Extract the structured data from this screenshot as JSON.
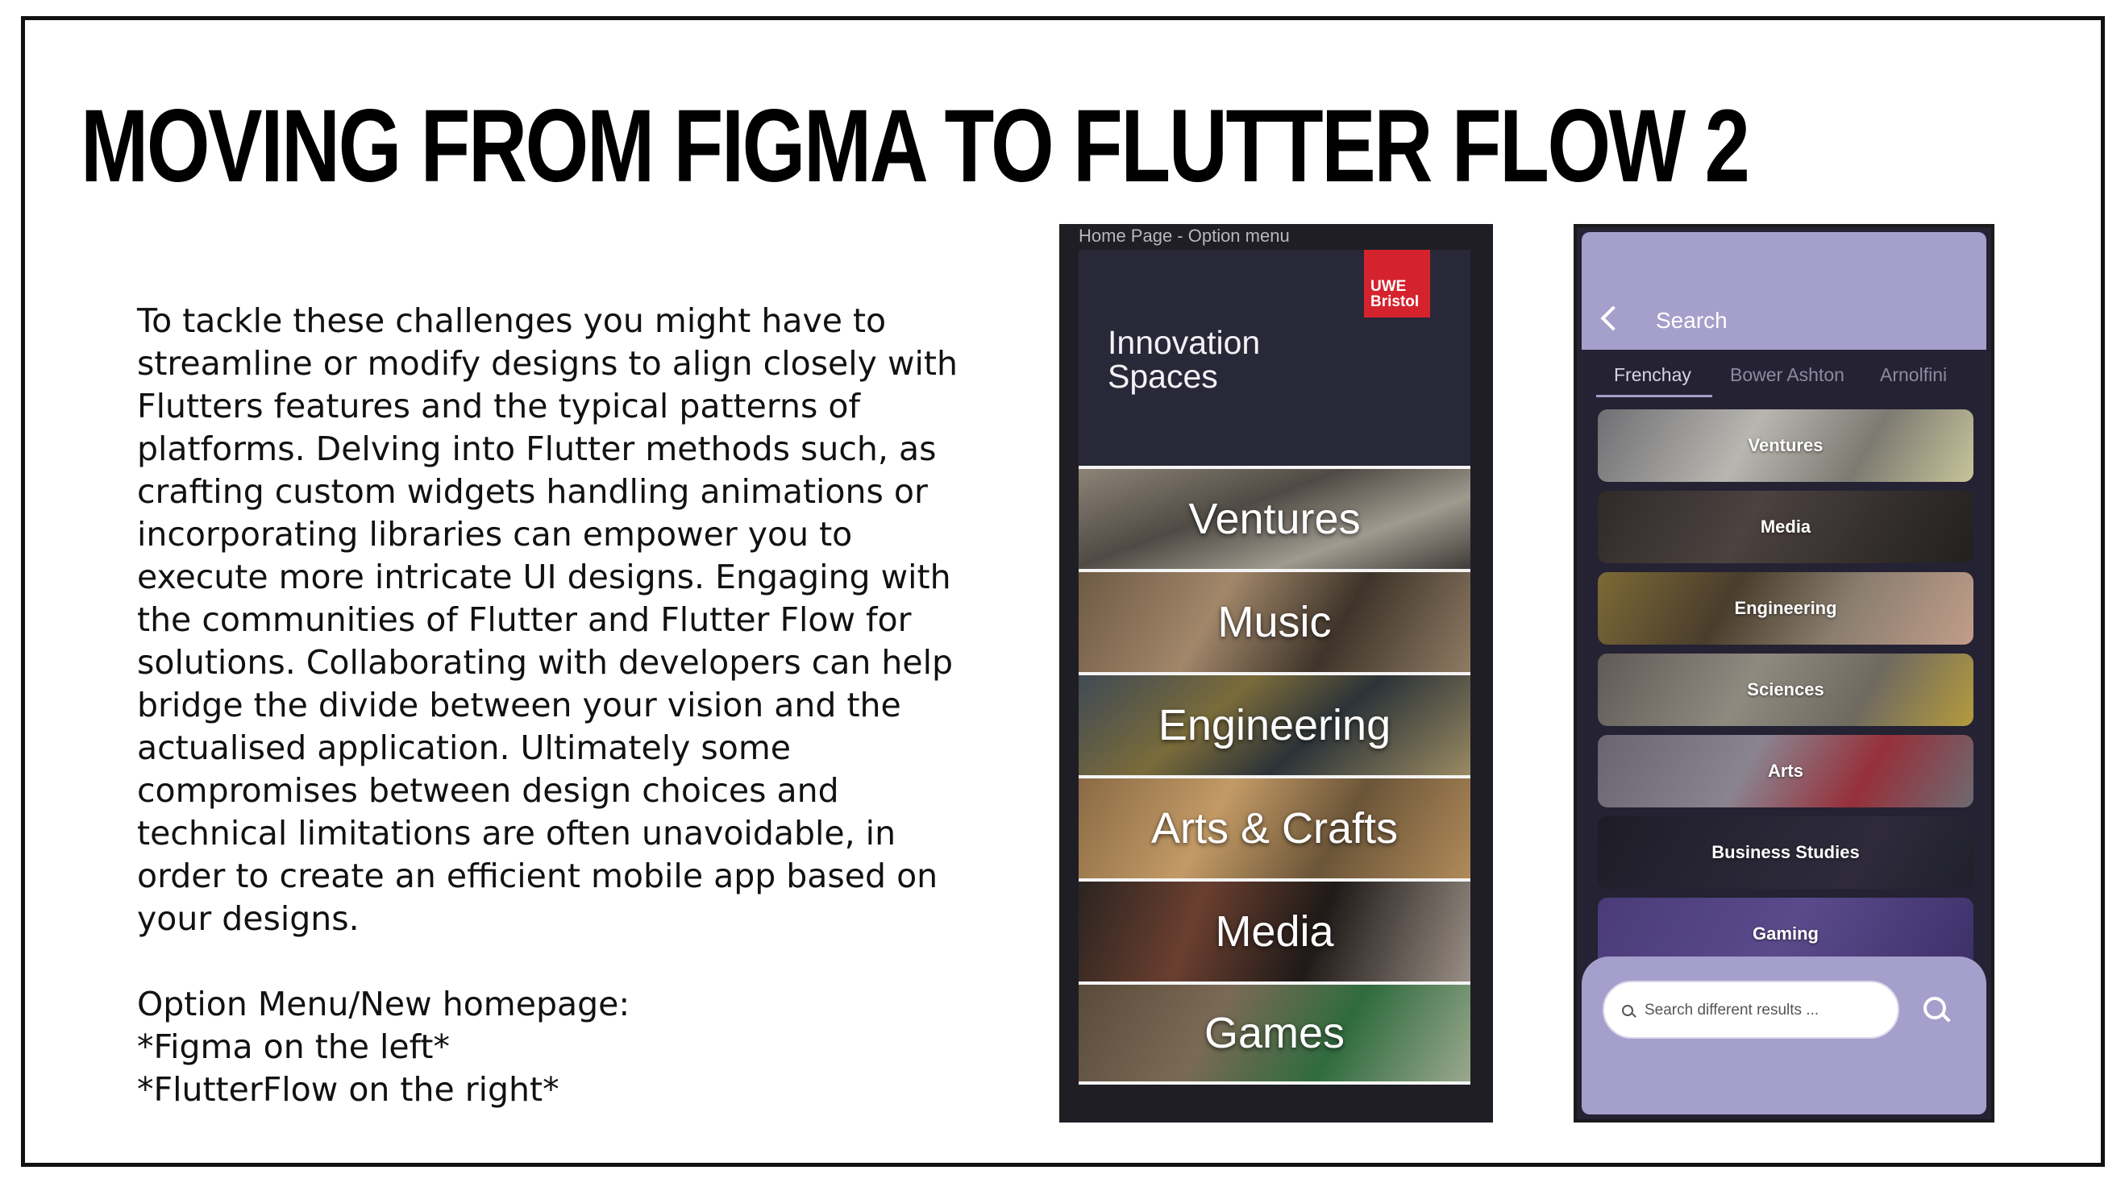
{
  "slide": {
    "title": "MOVING FROM FIGMA TO FLUTTER FLOW 2",
    "paragraph": "To tackle these challenges you might have to streamline or modify designs to align closely with Flutters features and the typical patterns of platforms. Delving into Flutter methods such, as crafting custom widgets handling animations or incorporating libraries can empower you to execute more intricate UI designs. Engaging with the communities of Flutter and Flutter Flow for solutions. Collaborating with developers can help bridge the divide between your vision and the actualised application. Ultimately some compromises between design choices and technical limitations are often unavoidable, in order to create an efficient mobile app based on your designs.",
    "note_line1": "Option Menu/New homepage:",
    "note_line2": "*Figma on the left*",
    "note_line3": "*FlutterFlow on the right*"
  },
  "figma": {
    "caption": "Home Page - Option menu",
    "logo_line1": "UWE",
    "logo_line2": "Bristol",
    "logo_color": "#d5232d",
    "heading_line1": "Innovation",
    "heading_line2": "Spaces",
    "tiles": [
      {
        "label": "Ventures"
      },
      {
        "label": "Music"
      },
      {
        "label": "Engineering"
      },
      {
        "label": "Arts & Crafts"
      },
      {
        "label": "Media"
      },
      {
        "label": "Games"
      }
    ]
  },
  "flutterflow": {
    "back_icon": "chevron-left-icon",
    "search_title": "Search",
    "accent_color": "#a59fcb",
    "tabs": [
      {
        "label": "Frenchay",
        "active": true
      },
      {
        "label": "Bower Ashton",
        "active": false
      },
      {
        "label": "Arnolfini",
        "active": false
      }
    ],
    "cards": [
      {
        "label": "Ventures"
      },
      {
        "label": "Media"
      },
      {
        "label": "Engineering"
      },
      {
        "label": "Sciences"
      },
      {
        "label": "Arts"
      },
      {
        "label": "Business Studies"
      },
      {
        "label": "Gaming"
      }
    ],
    "search_placeholder": "Search different results ...",
    "search_icon": "search-icon"
  }
}
